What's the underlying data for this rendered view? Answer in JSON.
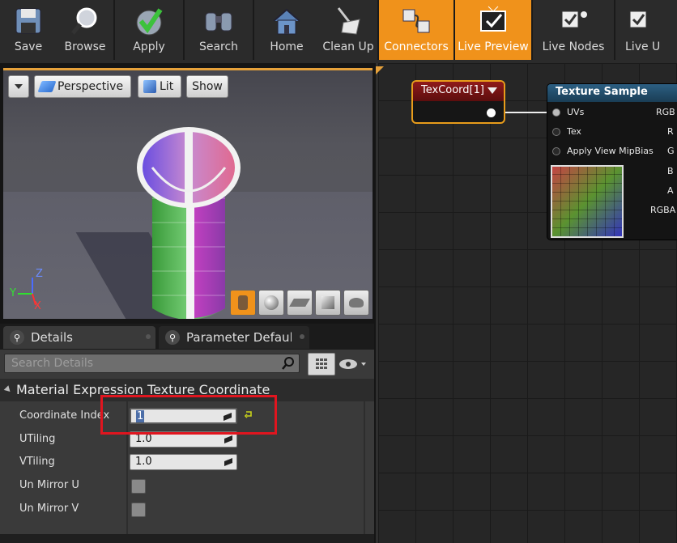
{
  "toolbar": {
    "buttons": [
      {
        "label": "Save",
        "icon": "floppy-disk-icon"
      },
      {
        "label": "Browse",
        "icon": "magnifier-icon"
      },
      {
        "label": "Apply",
        "icon": "checkmark-icon"
      },
      {
        "label": "Search",
        "icon": "binoculars-icon"
      },
      {
        "label": "Home",
        "icon": "house-icon"
      },
      {
        "label": "Clean Up",
        "icon": "broom-icon"
      },
      {
        "label": "Connectors",
        "icon": "connectors-icon",
        "active": true
      },
      {
        "label": "Live Preview",
        "icon": "tv-icon",
        "active": true
      },
      {
        "label": "Live Nodes",
        "icon": "live-nodes-icon"
      },
      {
        "label": "Live U",
        "icon": "live-update-icon"
      }
    ],
    "active_color": "#f0921b"
  },
  "viewport": {
    "projection_label": "Perspective",
    "lighting_label": "Lit",
    "show_label": "Show",
    "axis_z": "Z",
    "axis_y": "Y",
    "axis_x": "X",
    "preview_shapes": [
      "cylinder-icon",
      "sphere-icon",
      "plane-icon",
      "cube-icon",
      "teapot-icon"
    ]
  },
  "graph": {
    "texcoord_node": {
      "title": "TexCoord[1]"
    },
    "texture_sample_node": {
      "title": "Texture Sample",
      "inputs": [
        "UVs",
        "Tex",
        "Apply View MipBias"
      ],
      "outputs": [
        "RGB",
        "R",
        "G",
        "B",
        "A",
        "RGBA"
      ]
    }
  },
  "details": {
    "tab_details": "Details",
    "tab_parameters": "Parameter Defaults",
    "search_placeholder": "Search Details",
    "category": "Material Expression Texture Coordinate",
    "properties": {
      "coordinate_index": {
        "label": "Coordinate Index",
        "value": "1"
      },
      "utiling": {
        "label": "UTiling",
        "value": "1.0"
      },
      "vtiling": {
        "label": "VTiling",
        "value": "1.0"
      },
      "un_mirror_u": {
        "label": "Un Mirror U",
        "checked": false
      },
      "un_mirror_v": {
        "label": "Un Mirror V",
        "checked": false
      }
    },
    "highlight_color": "#e0151f"
  }
}
